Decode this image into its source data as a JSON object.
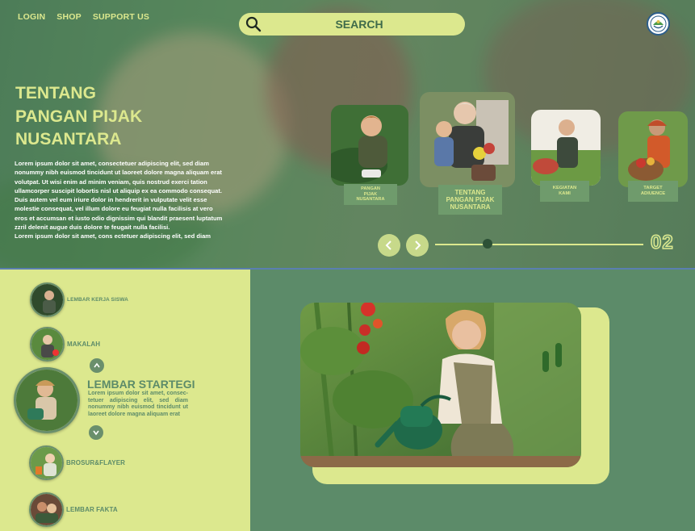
{
  "nav": {
    "login": "LOGIN",
    "shop": "SHOP",
    "support": "SUPPORT US"
  },
  "search": {
    "label": "SEARCH"
  },
  "hero": {
    "title_line1": "TENTANG",
    "title_line2": "PANGAN PIJAK",
    "title_line3": "NUSANTARA",
    "body_line1": "Lorem ipsum dolor sit amet, consectetuer adipiscing elit, sed diam",
    "body_line2": "nonummy nibh euismod tincidunt ut laoreet dolore magna aliquam erat",
    "body_line3": "volutpat. Ut wisi enim ad minim veniam, quis nostrud exerci tation",
    "body_line4": "ullamcorper suscipit lobortis nisl ut aliquip ex ea commodo consequat.",
    "body_line5": "Duis autem vel eum iriure dolor in hendrerit in vulputate velit esse",
    "body_line6": "molestie consequat, vel illum dolore eu feugiat nulla facilisis at vero",
    "body_line7": "eros et accumsan et iusto odio dignissim qui blandit praesent luptatum",
    "body_line8": "zzril delenit augue duis dolore te feugait nulla facilisi.",
    "body_line9": "Lorem ipsum dolor sit amet, cons ectetuer adipiscing elit, sed diam"
  },
  "carousel": {
    "cards": [
      {
        "label_l1": "PANGAN",
        "label_l2": "PIJAK",
        "label_l3": "NUSANTARA"
      },
      {
        "label_l1": "TENTANG",
        "label_l2": "PANGAN PIJAK",
        "label_l3": "NUSANTARA"
      },
      {
        "label_l1": "KEGIATAN",
        "label_l2": "KAMI"
      },
      {
        "label_l1": "TARGET",
        "label_l2": "ADIUENCE"
      }
    ],
    "page_number": "02",
    "progress": 0.25
  },
  "sidebar": {
    "items": [
      {
        "label": "LEMBAR KERJA SISWA"
      },
      {
        "label": "MAKALAH"
      },
      {
        "label": "BROSUR&FLAYER"
      },
      {
        "label": "LEMBAR FAKTA"
      }
    ],
    "active": {
      "title": "LEMBAR STARTEGI",
      "description": "Lorem ipsum dolor sit amet, consec-tetuer adipiscing elit, sed diam nonummy nibh euismod tincidunt ut laoreet dolore magna aliquam erat"
    }
  },
  "colors": {
    "accent": "#dce88e",
    "green": "#5c8b69",
    "dark_green": "#2d5136"
  },
  "icons": [
    "search-icon",
    "chevron-left-icon",
    "chevron-right-icon",
    "chevron-up-icon",
    "chevron-down-icon",
    "logo-emblem"
  ]
}
